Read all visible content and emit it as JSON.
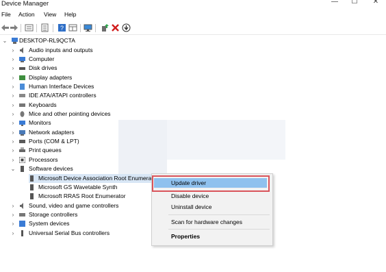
{
  "window": {
    "title": "Device Manager",
    "minimize": "—",
    "maximize": "☐",
    "close": "✕"
  },
  "menu": [
    "File",
    "Action",
    "View",
    "Help"
  ],
  "toolbar": {
    "icons": [
      "back-icon",
      "forward-icon",
      "properties-icon",
      "show-hidden-icon",
      "help-icon",
      "action-pane-icon",
      "monitor-icon",
      "update-driver-icon",
      "uninstall-icon",
      "download-icon"
    ]
  },
  "tree": {
    "root": "DESKTOP-RL9QCTA",
    "categories": [
      "Audio inputs and outputs",
      "Computer",
      "Disk drives",
      "Display adapters",
      "Human Interface Devices",
      "IDE ATA/ATAPI controllers",
      "Keyboards",
      "Mice and other pointing devices",
      "Monitors",
      "Network adapters",
      "Ports (COM & LPT)",
      "Print queues",
      "Processors",
      "Software devices"
    ],
    "software_children": [
      "Microsoft Device Association Root Enumerator",
      "Microsoft GS Wavetable Synth",
      "Microsoft RRAS Root Enumerator"
    ],
    "categories_after": [
      "Sound, video and game controllers",
      "Storage controllers",
      "System devices",
      "Universal Serial Bus controllers"
    ]
  },
  "context_menu": {
    "items": [
      "Update driver",
      "Disable device",
      "Uninstall device",
      "Scan for hardware changes",
      "Properties"
    ],
    "highlighted": "Update driver",
    "highlight_color": "#8fc1ee",
    "annotation_color": "#d9535a"
  }
}
